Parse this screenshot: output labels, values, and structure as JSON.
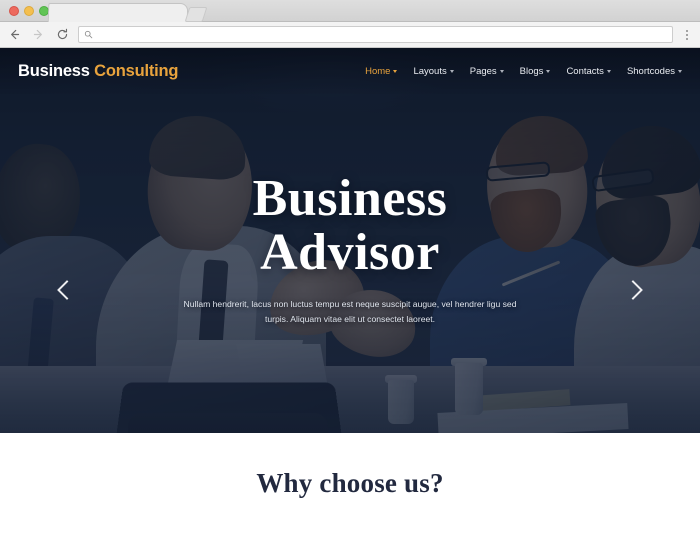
{
  "browser": {
    "window_controls": [
      "close",
      "minimize",
      "maximize"
    ],
    "tab_title": "",
    "back_label": "Back",
    "forward_label": "Forward",
    "reload_label": "Reload",
    "url_value": "",
    "url_placeholder": "",
    "search_icon": "search-icon",
    "menu_label": "Customize and control"
  },
  "site": {
    "brand": {
      "part1": "Business",
      "part2": "Consulting",
      "accent_color": "#e8a33d"
    },
    "nav": [
      {
        "label": "Home",
        "active": true,
        "has_dropdown": true
      },
      {
        "label": "Layouts",
        "active": false,
        "has_dropdown": true
      },
      {
        "label": "Pages",
        "active": false,
        "has_dropdown": true
      },
      {
        "label": "Blogs",
        "active": false,
        "has_dropdown": true
      },
      {
        "label": "Contacts",
        "active": false,
        "has_dropdown": true
      },
      {
        "label": "Shortcodes",
        "active": false,
        "has_dropdown": true
      }
    ]
  },
  "hero": {
    "title_line1": "Business",
    "title_line2": "Advisor",
    "subtitle": "Nullam hendrerit, lacus non luctus tempu est neque suscipit augue, vel hendrer ligu sed turpis. Aliquam vitae elit ut consectet laoreet.",
    "prev_label": "Previous slide",
    "next_label": "Next slide",
    "overlay_color": "#101a2c"
  },
  "why_section": {
    "title": "Why choose us?",
    "title_color": "#22293f"
  }
}
